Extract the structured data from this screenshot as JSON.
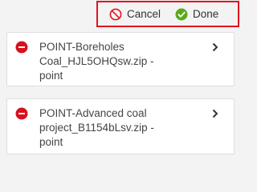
{
  "toolbar": {
    "cancel_label": "Cancel",
    "done_label": "Done",
    "cancel_icon": "cancel-icon",
    "done_icon": "check-circle-icon",
    "highlight_color": "#e0141e",
    "cancel_color": "#e0141e",
    "done_color": "#5aaa1e"
  },
  "items": [
    {
      "lines": [
        "POINT-Boreholes",
        "Coal_HJL5OHQsw.zip -",
        "point"
      ],
      "remove_icon": "remove-circle-icon",
      "chevron_icon": "chevron-right-icon"
    },
    {
      "lines": [
        "POINT-Advanced coal",
        "project_B1154bLsv.zip -",
        "point"
      ],
      "remove_icon": "remove-circle-icon",
      "chevron_icon": "chevron-right-icon"
    }
  ],
  "colors": {
    "background": "#f3f3f3",
    "card": "#ffffff",
    "remove": "#d8111b"
  }
}
